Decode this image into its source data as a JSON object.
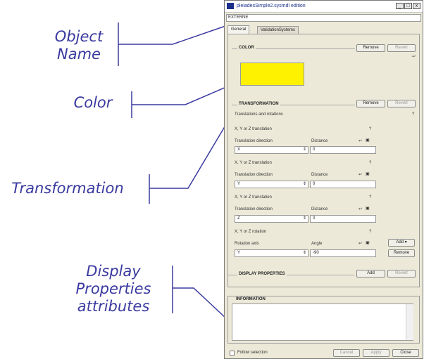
{
  "callouts": {
    "object_name": "Object\nName",
    "color": "Color",
    "transformation": "Transformation",
    "display": "Display\nProperties\nattributes"
  },
  "window": {
    "title": "pleiadesSimple2.sysmdl edition",
    "min": "_",
    "max": "□",
    "close": "x",
    "object_name": "EXTERNE"
  },
  "tabs": [
    "General",
    "ValidationSystems"
  ],
  "color_section": {
    "header": "COLOR",
    "remove": "Remove",
    "revert": "Revert",
    "swatch_color": "#fef200",
    "icon": "↩"
  },
  "transformation": {
    "header": "TRANSFORMATION",
    "remove": "Remove",
    "revert": "Revert",
    "subtitle": "Translations and rotations",
    "help": "?",
    "blocks": [
      {
        "title": "X, Y or Z translation",
        "col1": "Translation direction",
        "col2": "Distance",
        "combo": "X",
        "value": "0"
      },
      {
        "title": "X, Y or Z translation",
        "col1": "Translation direction",
        "col2": "Distance",
        "combo": "Y",
        "value": "0"
      },
      {
        "title": "X, Y or Z translation",
        "col1": "Translation direction",
        "col2": "Distance",
        "combo": "Z",
        "value": "0"
      },
      {
        "title": "X, Y or Z rotation",
        "col1": "Rotation axis",
        "col2": "Angle",
        "combo": "Y",
        "value": "-90"
      }
    ],
    "add": "Add ▾",
    "remove_row": "Remove"
  },
  "display_section": {
    "header": "DISPLAY PROPERTIES",
    "add": "Add",
    "revert": "Revert"
  },
  "information": {
    "header": "INFORMATION"
  },
  "footer": {
    "follow": "Follow selection",
    "cancel": "Cancel",
    "apply": "Apply",
    "close": "Close"
  }
}
